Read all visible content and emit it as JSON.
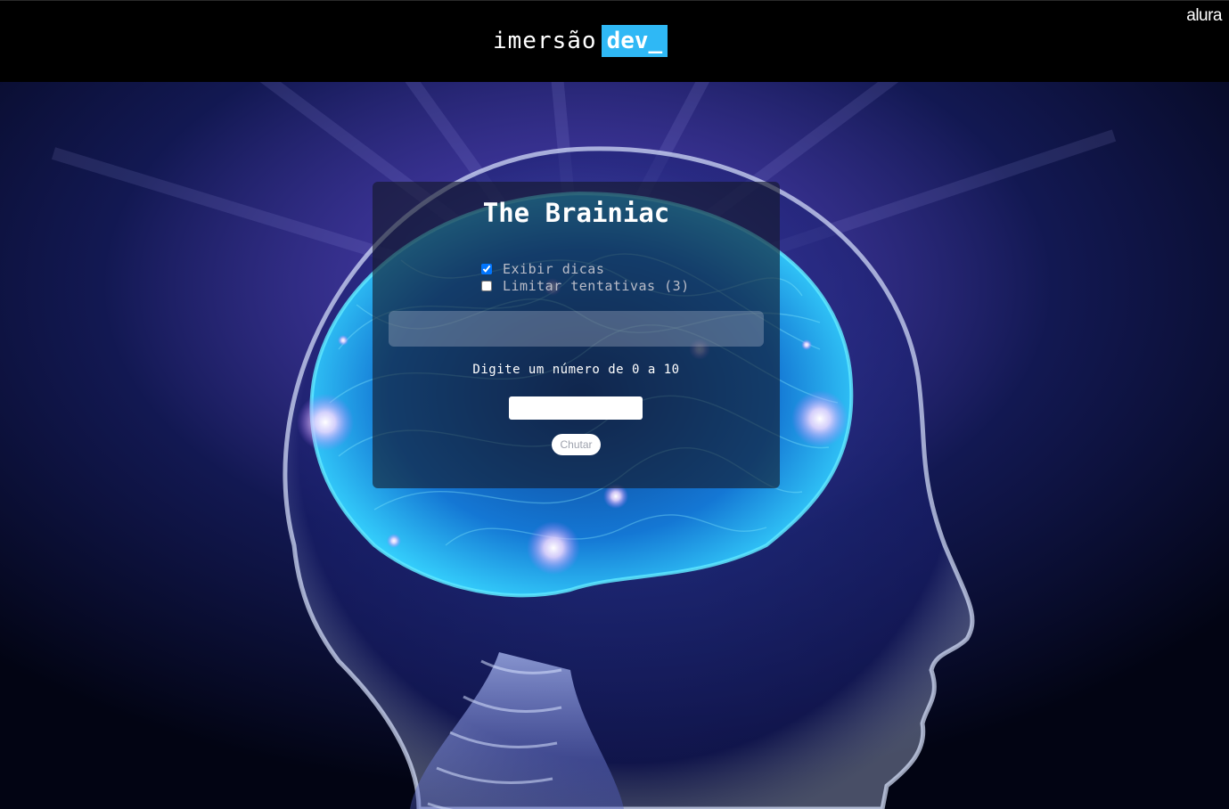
{
  "header": {
    "brand_word": "imersão",
    "brand_dev": "dev_",
    "partner": "alura"
  },
  "game": {
    "title": "The Brainiac",
    "options": [
      {
        "label": "Exibir dicas",
        "checked": true
      },
      {
        "label": "Limitar tentativas (3)",
        "checked": false
      }
    ],
    "hint_text": "",
    "prompt": "Digite um número de 0 a 10",
    "guess_value": "",
    "guess_button": "Chutar"
  },
  "background": {
    "image": "glowing-brain-head-xray",
    "colors": {
      "deep": "#050a20",
      "glow": "#6a63d8",
      "brain": "#1fb7ff",
      "highlight": "#ffffff"
    }
  },
  "colors": {
    "accent": "#2fb8f5",
    "topbar": "#000000"
  }
}
